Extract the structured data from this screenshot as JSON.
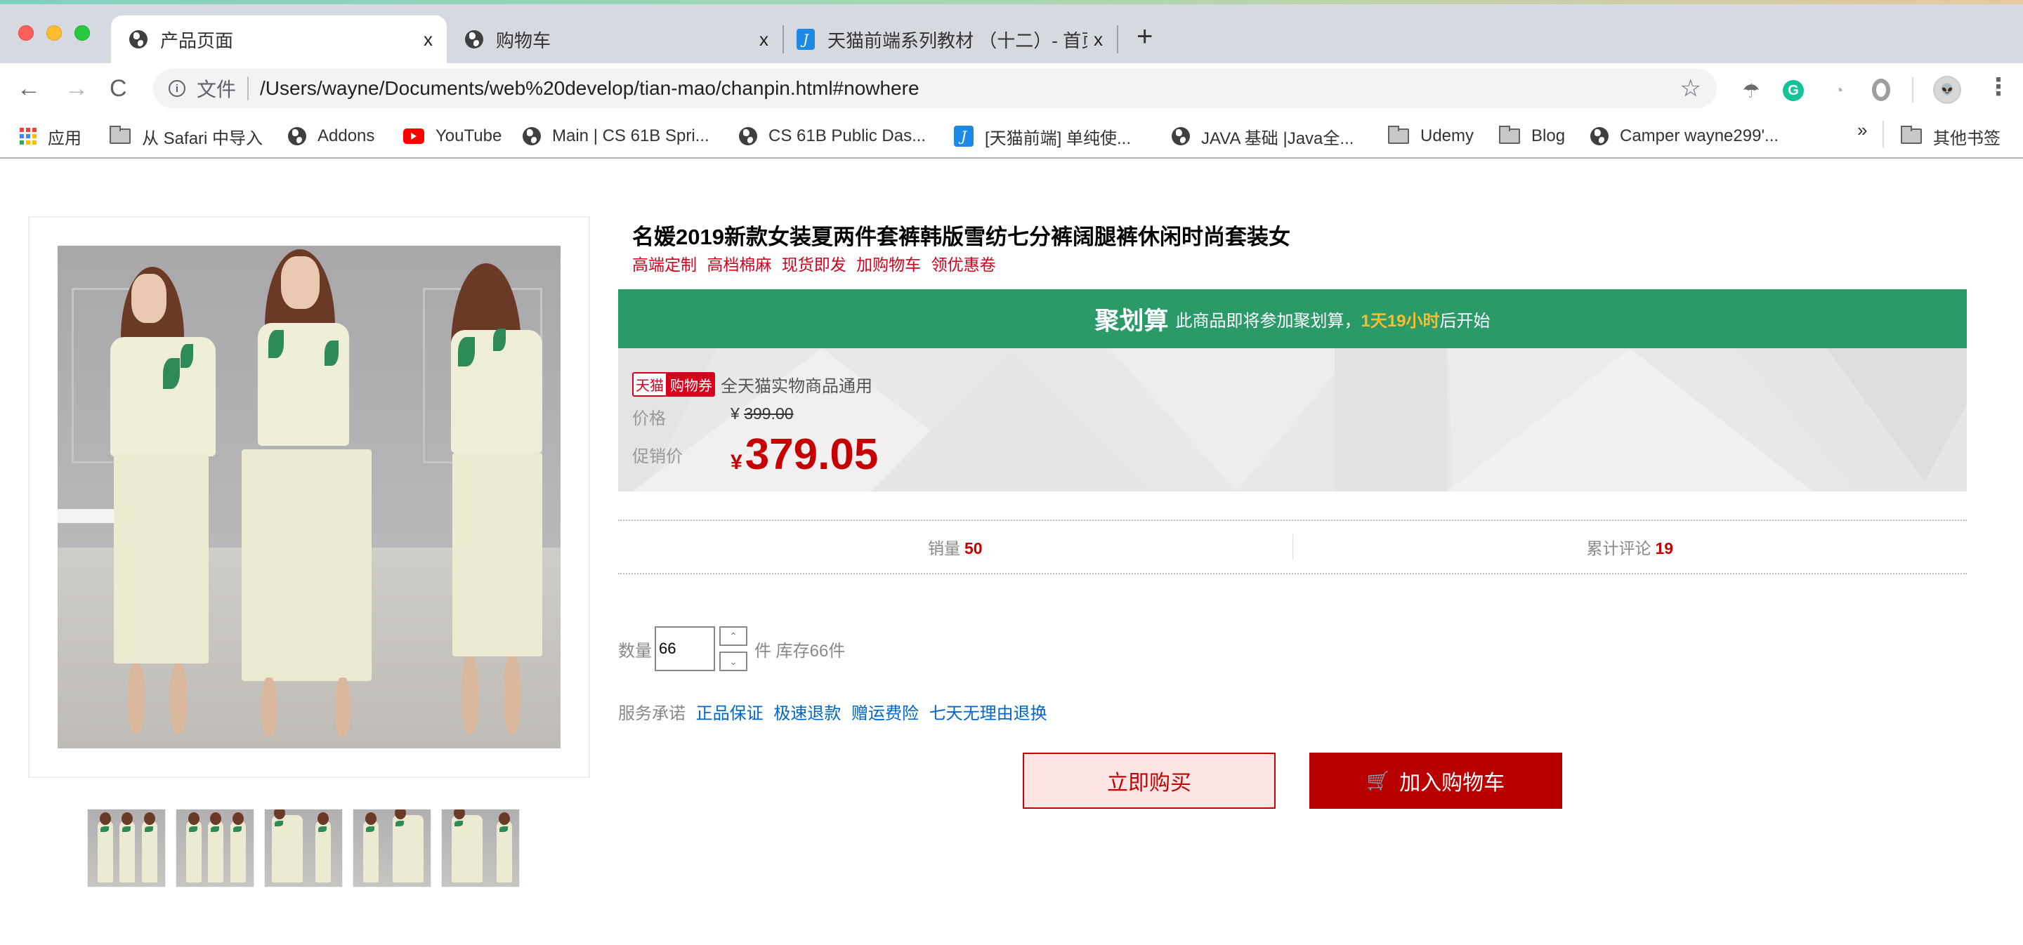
{
  "browser": {
    "tabs": [
      {
        "title": "产品页面",
        "icon": "globe-icon",
        "active": true
      },
      {
        "title": "购物车",
        "icon": "globe-icon",
        "active": false
      },
      {
        "title": "天猫前端系列教材 （十二）- 首页",
        "icon": "j-site-icon",
        "active": false
      }
    ],
    "close_glyph": "x",
    "new_tab_glyph": "+",
    "nav": {
      "back": "←",
      "forward": "→",
      "reload": "C"
    },
    "omnibox": {
      "scheme_label": "文件",
      "url": "/Users/wayne/Documents/web%20develop/tian-mao/chanpin.html#nowhere"
    },
    "extensions": [
      "parachute-icon",
      "grammarly-icon",
      "speedometer-icon",
      "ring-icon"
    ],
    "bookmarks": [
      {
        "label": "应用",
        "icon": "apps-grid-icon"
      },
      {
        "label": "从 Safari 中导入",
        "icon": "folder-icon"
      },
      {
        "label": "Addons",
        "icon": "globe-icon"
      },
      {
        "label": "YouTube",
        "icon": "youtube-icon"
      },
      {
        "label": "Main | CS 61B Spri...",
        "icon": "globe-icon"
      },
      {
        "label": "CS 61B Public Das...",
        "icon": "globe-icon"
      },
      {
        "label": "[天猫前端] 单纯使...",
        "icon": "j-site-icon"
      },
      {
        "label": "JAVA 基础 |Java全...",
        "icon": "globe-icon"
      },
      {
        "label": "Udemy",
        "icon": "folder-icon"
      },
      {
        "label": "Blog",
        "icon": "folder-icon"
      },
      {
        "label": "Camper wayne299'...",
        "icon": "globe-icon"
      }
    ],
    "bookmarks_more": "»",
    "other_bookmarks": "其他书签"
  },
  "product": {
    "title": "名媛2019新款女装夏两件套裤韩版雪纺七分裤阔腿裤休闲时尚套装女",
    "tags": [
      "高端定制",
      "高档棉麻",
      "现货即发",
      "加购物车",
      "领优惠卷"
    ],
    "thumbnail_count": 5,
    "juhuasuan": {
      "label": "聚划算",
      "message_prefix": "此商品即将参加聚划算，",
      "countdown": "1天19小时",
      "message_suffix": "后开始"
    },
    "coupon": {
      "brand": "天猫",
      "type": "购物券",
      "desc": "全天猫实物商品通用"
    },
    "price_label": "价格",
    "original_price": {
      "currency": "¥",
      "value": "399.00"
    },
    "promo_label": "促销价",
    "promo_price": {
      "currency": "¥",
      "value": "379.05"
    },
    "stats": [
      {
        "label": "销量",
        "value": "50"
      },
      {
        "label": "累计评论",
        "value": "19"
      }
    ],
    "quantity": {
      "label": "数量",
      "value": "66",
      "unit": "件",
      "stock": "库存66件",
      "up": "⌃",
      "down": "⌄"
    },
    "service": {
      "label": "服务承诺",
      "items": [
        "正品保证",
        "极速退款",
        "赠运费险",
        "七天无理由退换"
      ]
    },
    "buy_now": "立即购买",
    "add_to_cart": "加入购物车"
  },
  "colors": {
    "juhuasuan_green": "#2a9a69",
    "countdown_yellow": "#fbbd2b",
    "tmall_red": "#c40000",
    "tag_red": "#d6001c",
    "link_blue": "#0066cc"
  }
}
